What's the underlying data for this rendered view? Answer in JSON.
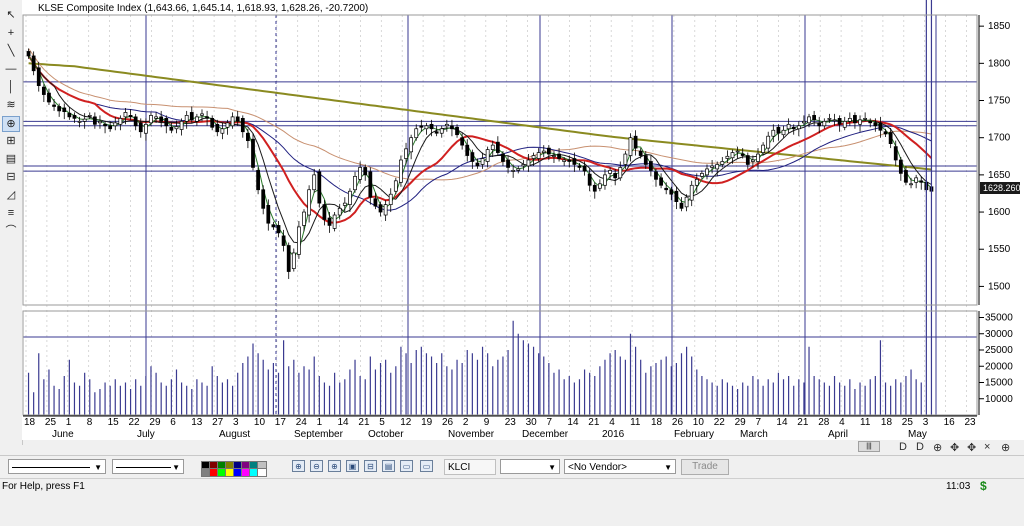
{
  "chart_header": {
    "title_text": "KLSE Composite Index (1,643.66, 1,645.14, 1,618.93, 1,628.26, -20.7200)"
  },
  "left_tools": [
    "arrow-select",
    "crosshair",
    "trendline",
    "horizontal-line",
    "vertical-line",
    "fibonacci",
    "magnifier",
    "zoom",
    "text",
    "channel",
    "pitchfork",
    "gann",
    "arc"
  ],
  "price_axis": {
    "ticks": [
      "1850",
      "1800",
      "1750",
      "1700",
      "1650",
      "1600",
      "1550",
      "1500"
    ],
    "last_price_label": "1628.260"
  },
  "volume_axis": {
    "ticks": [
      "35000",
      "30000",
      "25000",
      "20000",
      "15000",
      "10000"
    ]
  },
  "date_axis": {
    "day_labels": [
      "18",
      "25",
      "1",
      "8",
      "15",
      "22",
      "29",
      "6",
      "13",
      "27",
      "3",
      "10",
      "17",
      "24",
      "1",
      "14",
      "21",
      "5",
      "12",
      "19",
      "26",
      "2",
      "9",
      "23",
      "30",
      "7",
      "14",
      "21",
      "4",
      "11",
      "18",
      "26",
      "10",
      "22",
      "29",
      "7",
      "14",
      "21",
      "28",
      "4",
      "11",
      "18",
      "25",
      "3",
      "16",
      "23"
    ],
    "month_labels": [
      "June",
      "July",
      "August",
      "September",
      "October",
      "November",
      "December",
      "2016",
      "February",
      "March",
      "April",
      "May"
    ]
  },
  "toolbar": {
    "symbol_label": "KLCI",
    "vendor_select": "<No Vendor>",
    "trade_button": "Trade"
  },
  "palette_colors": [
    "#000000",
    "#800000",
    "#008000",
    "#808000",
    "#000080",
    "#800080",
    "#008080",
    "#c0c0c0",
    "#808080",
    "#ff0000",
    "#00ff00",
    "#ffff00",
    "#0000ff",
    "#ff00ff",
    "#00ffff",
    "#ffffff"
  ],
  "nav_buttons": [
    "D",
    "D",
    "⊕",
    "✥",
    "✥",
    "×",
    "⊕"
  ],
  "status": {
    "help_text": "For Help, press F1",
    "time": "11:03",
    "currency_symbol": "$"
  },
  "indicator_colors": {
    "ma_fast": "#2a7a2a",
    "ma_mid": "#1a1a1a",
    "ma_red": "#d02020",
    "ma_olive": "#8a8a20",
    "ma_tan": "#c89070",
    "ma_navy": "#202080",
    "grid_blue": "#24247a"
  },
  "chart_data": {
    "type": "candlestick",
    "title": "KLSE Composite Index",
    "ylim": [
      1475,
      1865
    ],
    "volume_ylim": [
      5000,
      37000
    ],
    "series": [
      {
        "name": "KLSE Composite Index",
        "values": [
          1810,
          1790,
          1770,
          1758,
          1748,
          1742,
          1736,
          1735,
          1728,
          1726,
          1722,
          1725,
          1730,
          1718,
          1722,
          1716,
          1712,
          1720,
          1726,
          1734,
          1728,
          1716,
          1708,
          1718,
          1730,
          1728,
          1722,
          1716,
          1710,
          1715,
          1722,
          1730,
          1724,
          1728,
          1732,
          1726,
          1714,
          1708,
          1712,
          1720,
          1728,
          1722,
          1708,
          1696,
          1660,
          1630,
          1605,
          1585,
          1580,
          1572,
          1555,
          1520,
          1545,
          1580,
          1600,
          1630,
          1650,
          1612,
          1590,
          1582,
          1596,
          1605,
          1612,
          1628,
          1648,
          1660,
          1650,
          1620,
          1608,
          1600,
          1610,
          1624,
          1642,
          1670,
          1685,
          1700,
          1712,
          1714,
          1716,
          1712,
          1706,
          1712,
          1718,
          1712,
          1704,
          1690,
          1676,
          1668,
          1662,
          1672,
          1684,
          1690,
          1680,
          1668,
          1660,
          1656,
          1658,
          1664,
          1670,
          1676,
          1680,
          1682,
          1678,
          1676,
          1672,
          1670,
          1668,
          1664,
          1660,
          1655,
          1636,
          1628,
          1638,
          1650,
          1656,
          1646,
          1660,
          1678,
          1700,
          1686,
          1676,
          1664,
          1656,
          1644,
          1636,
          1630,
          1624,
          1614,
          1605,
          1620,
          1636,
          1644,
          1652,
          1658,
          1662,
          1664,
          1668,
          1675,
          1680,
          1682,
          1676,
          1664,
          1670,
          1678,
          1690,
          1702,
          1710,
          1706,
          1710,
          1718,
          1712,
          1716,
          1722,
          1728,
          1724,
          1716,
          1722,
          1726,
          1724,
          1718,
          1722,
          1726,
          1720,
          1724,
          1726,
          1720,
          1716,
          1710,
          1705,
          1692,
          1670,
          1652,
          1640,
          1638,
          1646,
          1640,
          1630,
          1628
        ]
      },
      {
        "name": "Volume",
        "values": [
          18000,
          12000,
          24000,
          16000,
          19000,
          14000,
          13000,
          17000,
          22000,
          15000,
          14000,
          18000,
          16000,
          12000,
          13000,
          15000,
          14000,
          16000,
          14000,
          15000,
          13000,
          16000,
          14000,
          17000,
          20000,
          18000,
          15000,
          14000,
          16000,
          19000,
          15000,
          14000,
          13000,
          16000,
          15000,
          14000,
          20000,
          17000,
          15000,
          16000,
          14000,
          18000,
          21000,
          23000,
          27000,
          24000,
          22000,
          19000,
          21000,
          18000,
          28000,
          20000,
          22000,
          18000,
          20000,
          19000,
          23000,
          17000,
          15000,
          14000,
          18000,
          15000,
          16000,
          19000,
          22000,
          17000,
          16000,
          23000,
          19000,
          21000,
          22000,
          18000,
          20000,
          26000,
          24000,
          21000,
          25000,
          26000,
          24000,
          23000,
          21000,
          24000,
          20000,
          19000,
          22000,
          21000,
          25000,
          24000,
          22000,
          26000,
          24000,
          20000,
          22000,
          23000,
          25000,
          34000,
          30000,
          28000,
          27000,
          26000,
          24000,
          23000,
          21000,
          18000,
          19000,
          16000,
          17000,
          15000,
          16000,
          19000,
          18000,
          17000,
          20000,
          22000,
          24000,
          25000,
          23000,
          22000,
          30000,
          26000,
          22000,
          18000,
          20000,
          21000,
          22000,
          23000,
          20000,
          21000,
          24000,
          26000,
          23000,
          19000,
          17000,
          16000,
          15000,
          14000,
          16000,
          15000,
          14000,
          13000,
          15000,
          14000,
          17000,
          16000,
          14000,
          16000,
          15000,
          18000,
          16000,
          17000,
          14000,
          16000,
          15000,
          26000,
          17000,
          16000,
          15000,
          14000,
          17000,
          15000,
          14000,
          16000,
          13000,
          15000,
          14000,
          16000,
          17000,
          28000,
          15000,
          14000,
          16000,
          15000,
          17000,
          19000,
          16000,
          15000
        ]
      }
    ]
  }
}
